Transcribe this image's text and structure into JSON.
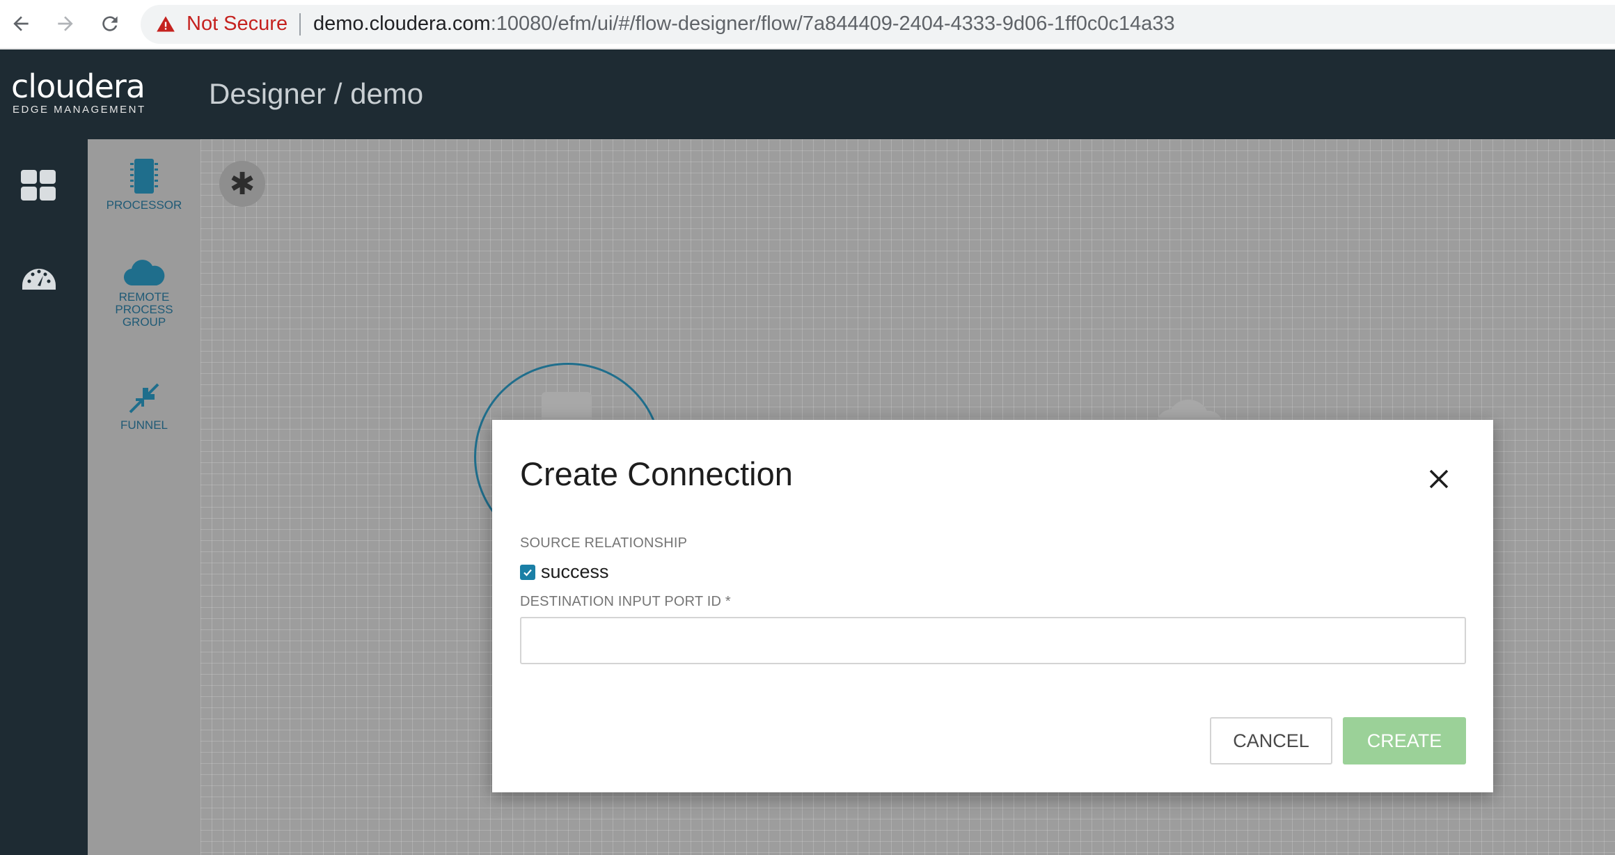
{
  "browser": {
    "not_secure": "Not Secure",
    "url_host": "demo.cloudera.com",
    "url_rest": ":10080/efm/ui/#/flow-designer/flow/7a844409-2404-4333-9d06-1ff0c0c14a33"
  },
  "header": {
    "brand": "cloudera",
    "brand_sub": "EDGE MANAGEMENT",
    "title": "Designer / demo"
  },
  "palette": {
    "items": [
      {
        "label": "PROCESSOR",
        "icon": "processor-icon"
      },
      {
        "label": "REMOTE PROCESS GROUP",
        "icon": "cloud-icon"
      },
      {
        "label": "FUNNEL",
        "icon": "funnel-icon"
      }
    ]
  },
  "modal": {
    "title": "Create Connection",
    "source_relationship_label": "SOURCE RELATIONSHIP",
    "relationship_option": "success",
    "relationship_checked": true,
    "destination_label": "DESTINATION INPUT PORT ID *",
    "destination_value": "",
    "cancel_label": "CANCEL",
    "create_label": "CREATE"
  },
  "colors": {
    "header_bg": "#1e2b33",
    "accent": "#1a7fa6",
    "create_button": "#9bd198",
    "warning_red": "#c5221f"
  }
}
